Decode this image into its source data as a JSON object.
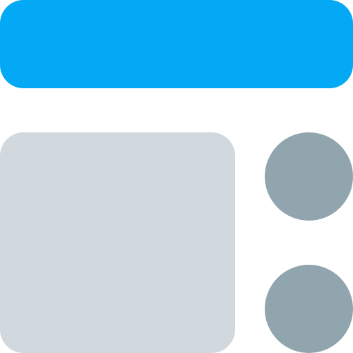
{
  "icon": {
    "name": "layout-icon",
    "colors": {
      "header": "#03A9F4",
      "panel": "#D1D8DE",
      "dots": "#91A5AF",
      "background": "#FFFFFF"
    }
  }
}
